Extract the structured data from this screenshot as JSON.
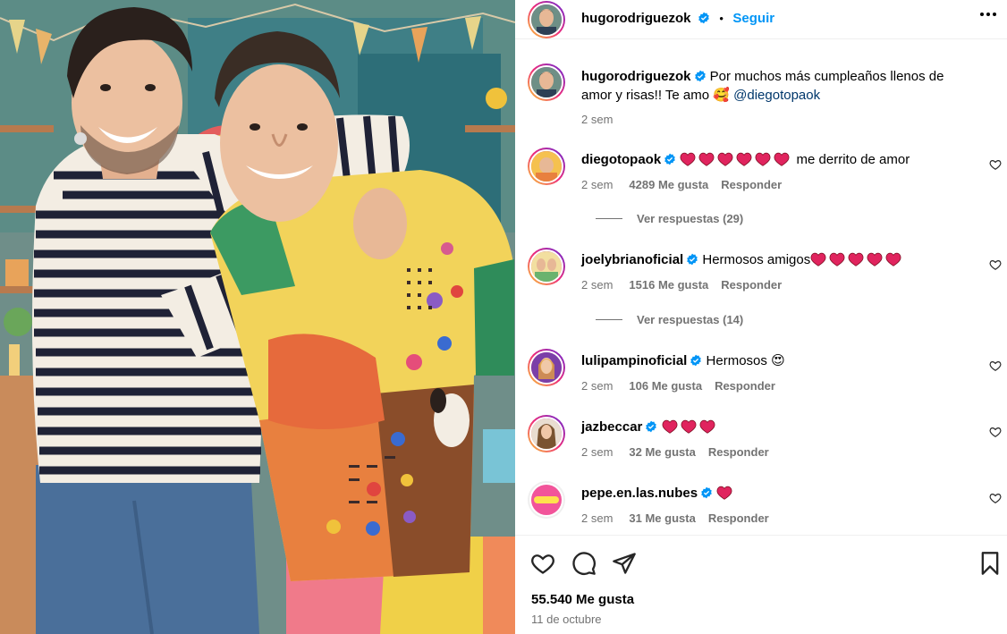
{
  "post": {
    "author": "hugorodriguezok",
    "follow_label": "Seguir",
    "dot": "•",
    "caption": {
      "author": "hugorodriguezok",
      "text": "Por muchos más cumpleaños llenos de amor y risas!! Te amo",
      "emoji": "🥰",
      "mention": "@diegotopaok",
      "time": "2 sem"
    },
    "likes_label": "55.540 Me gusta",
    "date": "11 de octubre"
  },
  "comments": [
    {
      "author": "diegotopaok",
      "hearts": 6,
      "text": "me derrito de amor",
      "time": "2 sem",
      "likes": "4289 Me gusta",
      "reply": "Responder",
      "view_replies": "Ver respuestas (29)"
    },
    {
      "author": "joelybrianoficial",
      "text": "Hermosos amigos",
      "hearts": 5,
      "time": "2 sem",
      "likes": "1516 Me gusta",
      "reply": "Responder",
      "view_replies": "Ver respuestas (14)"
    },
    {
      "author": "lulipampinoficial",
      "text": "Hermosos",
      "emoji": "😍",
      "time": "2 sem",
      "likes": "106 Me gusta",
      "reply": "Responder"
    },
    {
      "author": "jazbeccar",
      "hearts": 3,
      "time": "2 sem",
      "likes": "32 Me gusta",
      "reply": "Responder"
    },
    {
      "author": "pepe.en.las.nubes",
      "hearts": 1,
      "time": "2 sem",
      "likes": "31 Me gusta",
      "reply": "Responder"
    }
  ],
  "colors": {
    "link_blue": "#0095f6",
    "verified_blue": "#0095f6",
    "heart_red": "#e0245e",
    "meta_gray": "#737373"
  },
  "icons": [
    "verified-icon",
    "more-options-icon",
    "heart-icon",
    "comment-icon",
    "share-icon",
    "save-icon"
  ]
}
